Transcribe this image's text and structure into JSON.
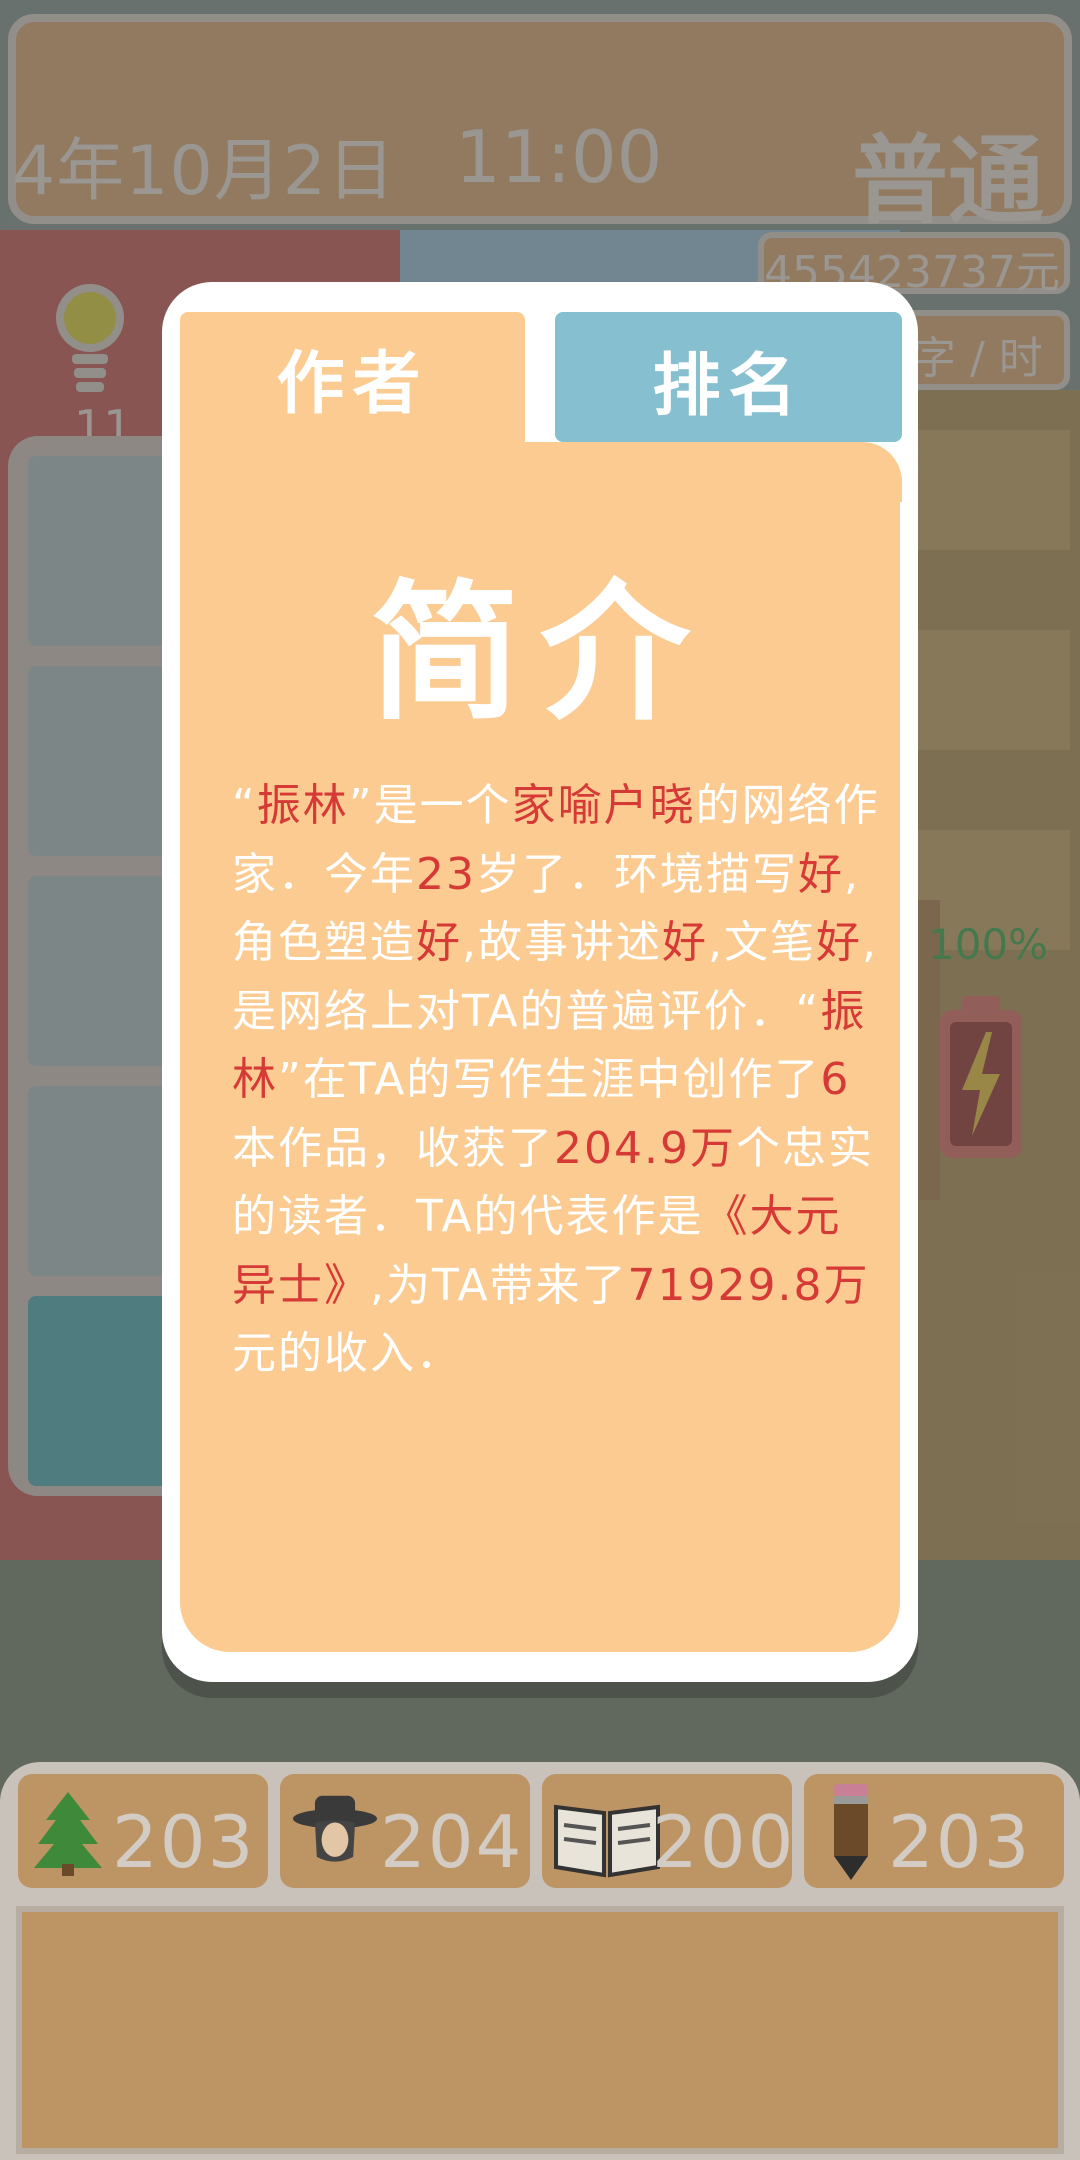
{
  "header": {
    "date": "4年10月2日",
    "time": "11:00",
    "mode": "普通",
    "money": "455423737元",
    "speed_unit": "字 / 时",
    "bulb_count": "11"
  },
  "battery": {
    "percent_label": "100%",
    "level": 1.0
  },
  "modal": {
    "tab_author": "作者",
    "tab_rank": "排名",
    "title": "简介",
    "description": [
      {
        "t": "“",
        "h": false
      },
      {
        "t": "振林",
        "h": true
      },
      {
        "t": "”是一个",
        "h": false
      },
      {
        "t": "家喻户晓",
        "h": true
      },
      {
        "t": "的网络作家．今年",
        "h": false
      },
      {
        "t": "23",
        "h": true
      },
      {
        "t": "岁了．环境描写",
        "h": false
      },
      {
        "t": "好",
        "h": true
      },
      {
        "t": ",角色塑造",
        "h": false
      },
      {
        "t": "好",
        "h": true
      },
      {
        "t": ",故事讲述",
        "h": false
      },
      {
        "t": "好",
        "h": true
      },
      {
        "t": ",文笔",
        "h": false
      },
      {
        "t": "好",
        "h": true
      },
      {
        "t": ",是网络上对TA的普遍评价．“",
        "h": false
      },
      {
        "t": "振林",
        "h": true
      },
      {
        "t": "”在TA的写作生涯中创作了",
        "h": false
      },
      {
        "t": "6",
        "h": true
      },
      {
        "t": "本作品，收获了",
        "h": false
      },
      {
        "t": "204.9万",
        "h": true
      },
      {
        "t": "个忠实的读者．TA的代表作是",
        "h": false
      },
      {
        "t": "《大元异士》",
        "h": true
      },
      {
        "t": ",为TA带来了",
        "h": false
      },
      {
        "t": "71929.8万",
        "h": true
      },
      {
        "t": "元的收入．",
        "h": false
      }
    ]
  },
  "stats": [
    {
      "icon": "tree-icon",
      "value": "203"
    },
    {
      "icon": "character-icon",
      "value": "204"
    },
    {
      "icon": "book-icon",
      "value": "200"
    },
    {
      "icon": "pencil-icon",
      "value": "203"
    }
  ],
  "colors": {
    "highlight": "#d63a36",
    "card": "#fccb91",
    "tab_inactive": "#85bfd0",
    "hud_brown": "#bd9463"
  }
}
